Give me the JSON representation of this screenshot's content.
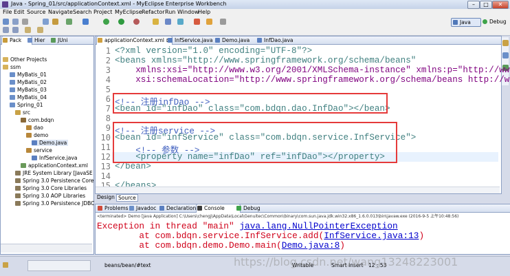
{
  "window": {
    "title": "Java - Spring_01/src/applicationContext.xml - MyEclipse Enterprise Workbench"
  },
  "menu": [
    "File",
    "Edit",
    "Source",
    "Navigate",
    "Search",
    "Project",
    "MyEclipse",
    "Refactor",
    "Run",
    "Window",
    "Help"
  ],
  "perspectives": {
    "java": "Java",
    "debug": "Debug"
  },
  "explorer": {
    "tabs": [
      "Pack",
      "Hier",
      "JUni"
    ],
    "tree": [
      "Other Projects",
      "ssm",
      "MyBatis_01",
      "MyBatis_02",
      "MyBatis_03",
      "MyBatis_04",
      "Spring_01",
      "src",
      "com.bdqn",
      "dao",
      "demo",
      "Demo.java",
      "service",
      "InfService.java",
      "applicationContext.xml",
      "JRE System Library [JavaSE",
      "Spring 3.0 Persistence Core",
      "Spring 3.0 Core Libraries",
      "Spring 3.0 AOP Libraries",
      "Spring 3.0 Persistence JDBC"
    ]
  },
  "editor": {
    "tabs": [
      "applicationContext.xml",
      "InfService.java",
      "Demo.java",
      "InfDao.java"
    ],
    "line_numbers": [
      "1",
      "2",
      "3",
      "4",
      "5",
      "6",
      "7",
      "8",
      "9",
      "10",
      "11",
      "12",
      "13",
      "14",
      "15"
    ],
    "lines": [
      "<?xml version=\"1.0\" encoding=\"UTF-8\"?>",
      "<beans xmlns=\"http://www.springframework.org/schema/beans\"",
      "    xmlns:xsi=\"http://www.w3.org/2001/XMLSchema-instance\" xmlns:p=\"http://www.",
      "    xsi:schemaLocation=\"http://www.springframework.org/schema/beans http://w",
      "",
      "<!-- 注册infDao -->",
      "<bean id=\"infDao\" class=\"com.bdqn.dao.InfDao\"></bean>",
      "",
      "<!-- 注册service -->",
      "<bean id=\"infService\" class=\"com.bdqn.service.InfService\">",
      "    <!-- 参数 -->",
      "    <property name=\"infDao\" ref=\"infDao\"></property>",
      "</bean>",
      "",
      "</beans>"
    ],
    "bottom_tabs": [
      "Design",
      "Source"
    ]
  },
  "console": {
    "tabs": [
      "Problems",
      "Javadoc",
      "Declaration",
      "Console",
      "Debug"
    ],
    "header": "<terminated> Demo [Java Application] C:\\Users\\chengj\\AppData\\Local\\Genuitec\\Common\\binary\\com.sun.java.jdk.win32.x86_1.6.0.013\\bin\\javaw.exe (2016-9-5 上午10:48:56)",
    "exception_prefix": "Exception in thread \"main\" ",
    "exception_class": "java.lang.NullPointerException",
    "trace1_prefix": "        at com.bdqn.service.InfService.add(",
    "trace1_link": "InfService.java:13",
    "trace1_suffix": ")",
    "trace2_prefix": "        at com.bdqn.demo.Demo.main(",
    "trace2_link": "Demo.java:8",
    "trace2_suffix": ")"
  },
  "status": {
    "path": "beans/bean/#text",
    "mode": "Writable",
    "insert": "Smart Insert",
    "position": "12 : 53"
  },
  "watermark": "https://blog.csdn.net/wang13248223001",
  "colors": {
    "highlight_box": "#e53a3a",
    "error_text": "#d0021b",
    "link": "#0000cc"
  }
}
